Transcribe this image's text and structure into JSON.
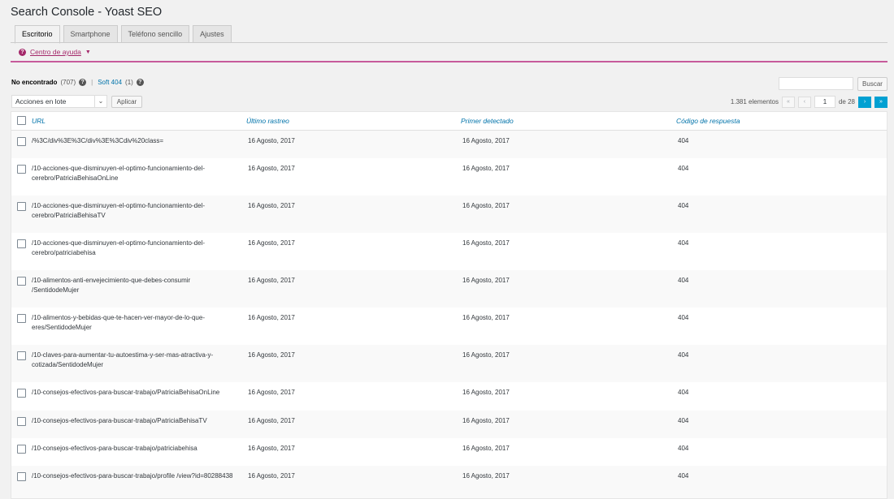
{
  "page": {
    "title": "Search Console - Yoast SEO"
  },
  "tabs": [
    {
      "label": "Escritorio",
      "active": true
    },
    {
      "label": "Smartphone",
      "active": false
    },
    {
      "label": "Teléfono sencillo",
      "active": false
    },
    {
      "label": "Ajustes",
      "active": false
    }
  ],
  "help": {
    "icon": "question-icon",
    "link": "Centro de ayuda",
    "caret": "▼"
  },
  "filters": {
    "not_found_label": "No encontrado",
    "not_found_count": "(707)",
    "separator": "|",
    "soft404_label": "Soft 404",
    "soft404_count": "(1)"
  },
  "search": {
    "value": "",
    "button": "Buscar"
  },
  "bulk": {
    "selected": "Acciones en lote",
    "apply": "Aplicar"
  },
  "pagination": {
    "total": "1.381 elementos",
    "first": "«",
    "prev": "‹",
    "current": "1",
    "of": "de 28",
    "next": "›",
    "last": "»"
  },
  "table": {
    "columns": [
      "URL",
      "Último rastreo",
      "Primer detectado",
      "Código de respuesta"
    ],
    "rows": [
      {
        "url": "/%3C/div%3E%3C/div%3E%3Cdiv%20class=",
        "last": "16 Agosto, 2017",
        "first": "16 Agosto, 2017",
        "code": "404"
      },
      {
        "url": "/10-acciones-que-disminuyen-el-optimo-funcionamiento-del-cerebro/PatriciaBehisaOnLine",
        "last": "16 Agosto, 2017",
        "first": "16 Agosto, 2017",
        "code": "404"
      },
      {
        "url": "/10-acciones-que-disminuyen-el-optimo-funcionamiento-del-cerebro/PatriciaBehisaTV",
        "last": "16 Agosto, 2017",
        "first": "16 Agosto, 2017",
        "code": "404"
      },
      {
        "url": "/10-acciones-que-disminuyen-el-optimo-funcionamiento-del-cerebro/patriciabehisa",
        "last": "16 Agosto, 2017",
        "first": "16 Agosto, 2017",
        "code": "404"
      },
      {
        "url": "/10-alimentos-anti-envejecimiento-que-debes-consumir /SentidodeMujer",
        "last": "16 Agosto, 2017",
        "first": "16 Agosto, 2017",
        "code": "404"
      },
      {
        "url": "/10-alimentos-y-bebidas-que-te-hacen-ver-mayor-de-lo-que-eres/SentidodeMujer",
        "last": "16 Agosto, 2017",
        "first": "16 Agosto, 2017",
        "code": "404"
      },
      {
        "url": "/10-claves-para-aumentar-tu-autoestima-y-ser-mas-atractiva-y-cotizada/SentidodeMujer",
        "last": "16 Agosto, 2017",
        "first": "16 Agosto, 2017",
        "code": "404"
      },
      {
        "url": "/10-consejos-efectivos-para-buscar-trabajo/PatriciaBehisaOnLine",
        "last": "16 Agosto, 2017",
        "first": "16 Agosto, 2017",
        "code": "404"
      },
      {
        "url": "/10-consejos-efectivos-para-buscar-trabajo/PatriciaBehisaTV",
        "last": "16 Agosto, 2017",
        "first": "16 Agosto, 2017",
        "code": "404"
      },
      {
        "url": "/10-consejos-efectivos-para-buscar-trabajo/patriciabehisa",
        "last": "16 Agosto, 2017",
        "first": "16 Agosto, 2017",
        "code": "404"
      },
      {
        "url": "/10-consejos-efectivos-para-buscar-trabajo/profile /view?id=80288438",
        "last": "16 Agosto, 2017",
        "first": "16 Agosto, 2017",
        "code": "404"
      }
    ]
  }
}
